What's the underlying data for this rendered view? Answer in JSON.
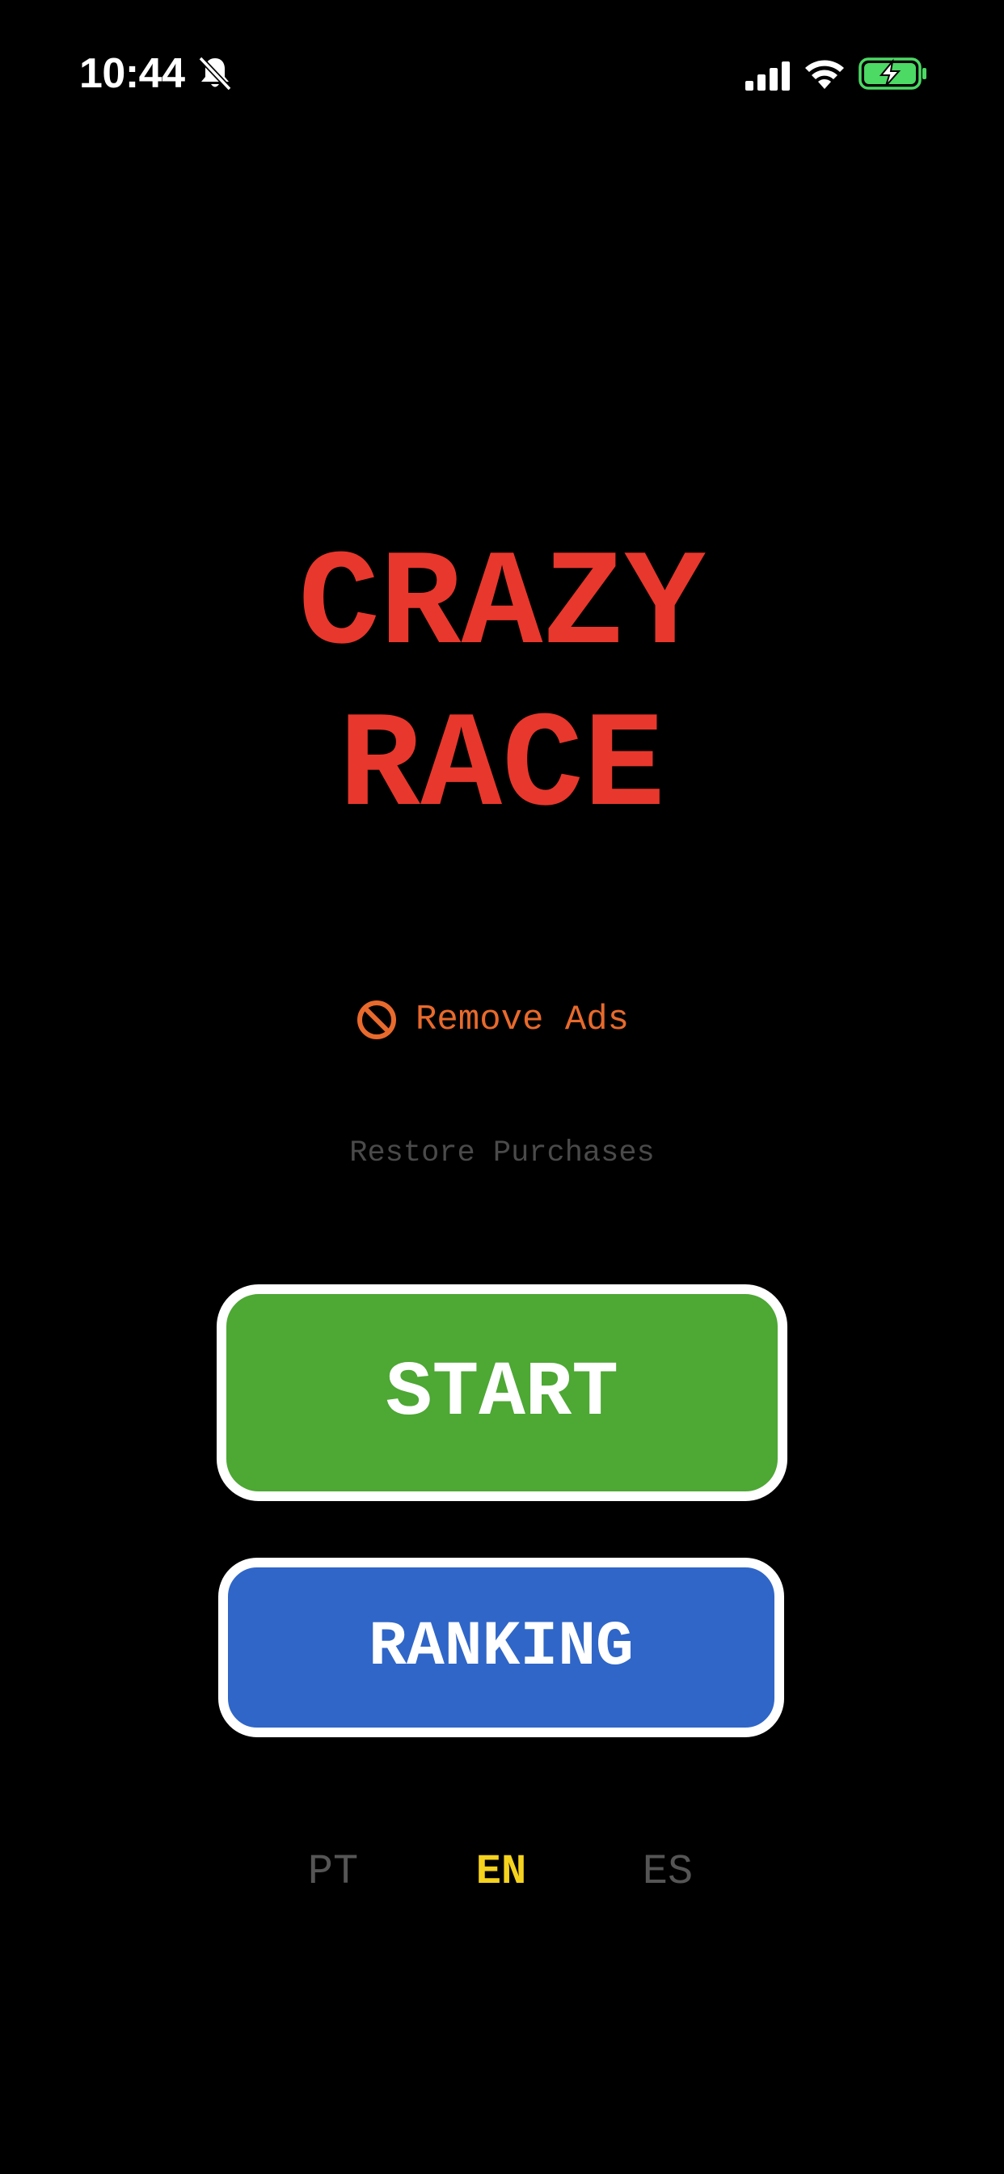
{
  "status_bar": {
    "time": "10:44",
    "icons": [
      "bell-slash-icon",
      "cellular-signal-icon",
      "wifi-icon",
      "battery-charging-icon"
    ],
    "battery_color": "#4cd964"
  },
  "title": {
    "line1": "CRAZY",
    "line2": "RACE",
    "color": "#e8372c"
  },
  "remove_ads": {
    "label": "Remove Ads",
    "icon": "no-ads-icon",
    "color": "#e86a2c"
  },
  "restore": {
    "label": "Restore Purchases"
  },
  "buttons": {
    "start": {
      "label": "START",
      "color": "#4da834"
    },
    "ranking": {
      "label": "RANKING",
      "color": "#2f66c8"
    }
  },
  "languages": {
    "options": [
      "PT",
      "EN",
      "ES"
    ],
    "selected": "EN",
    "selected_color": "#f5d21e"
  }
}
